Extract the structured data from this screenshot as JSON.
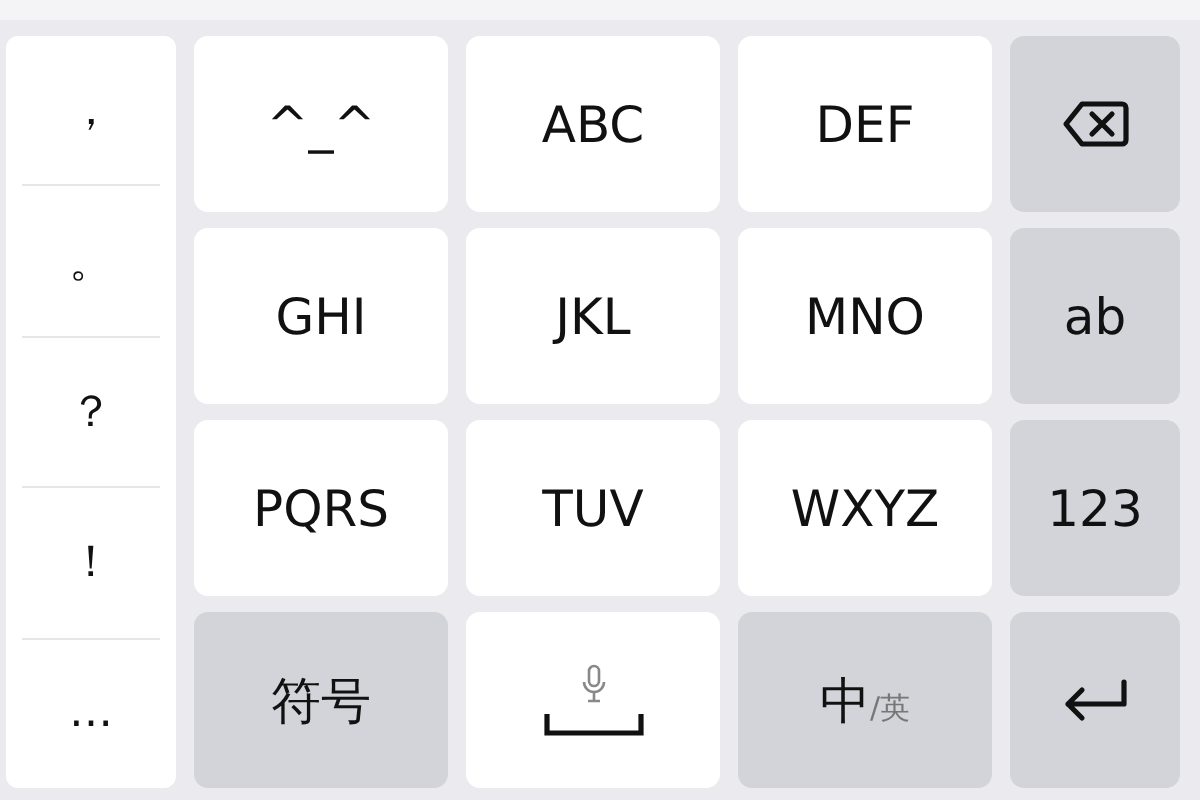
{
  "symbols": [
    "，",
    "。",
    "？",
    "！",
    "…"
  ],
  "keys": [
    {
      "kind": "key",
      "label": "^_^"
    },
    {
      "kind": "key",
      "label": "ABC"
    },
    {
      "kind": "key",
      "label": "DEF"
    },
    {
      "kind": "backspace"
    },
    {
      "kind": "key",
      "label": "GHI"
    },
    {
      "kind": "key",
      "label": "JKL"
    },
    {
      "kind": "key",
      "label": "MNO"
    },
    {
      "kind": "function",
      "label": "ab"
    },
    {
      "kind": "key",
      "label": "PQRS"
    },
    {
      "kind": "key",
      "label": "TUV"
    },
    {
      "kind": "key",
      "label": "WXYZ"
    },
    {
      "kind": "function",
      "label": "123"
    },
    {
      "kind": "function",
      "label": "符号"
    },
    {
      "kind": "space"
    },
    {
      "kind": "language",
      "label": "中",
      "sublabel": "/英"
    },
    {
      "kind": "enter"
    }
  ]
}
